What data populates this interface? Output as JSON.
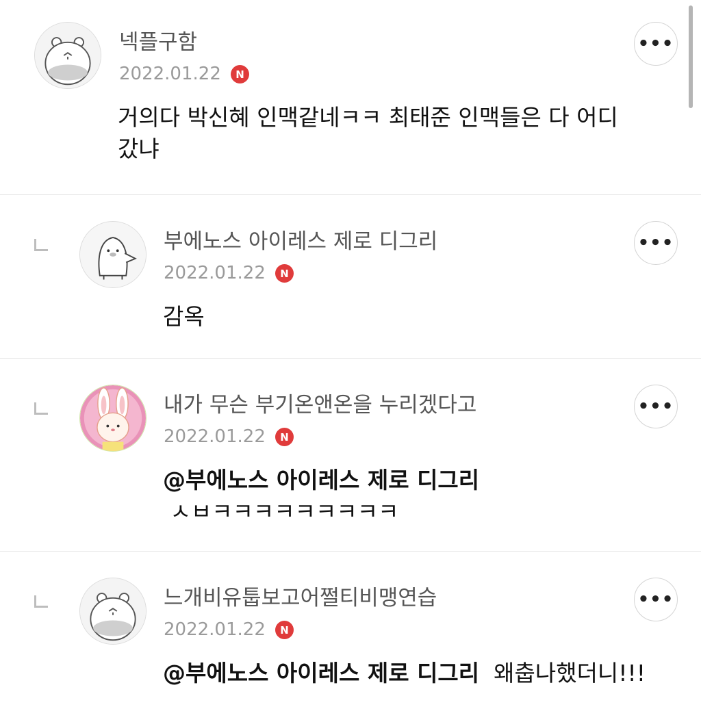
{
  "comments": [
    {
      "nickname": "넥플구함",
      "date": "2022.01.22",
      "badge": "N",
      "avatar_icon": "hamster-avatar-icon",
      "text_line1": "거의다 박신혜 인맥같네ㅋㅋ 최태준 인맥들은 다 어디",
      "text_line2": "갔냐",
      "more_label": "•••"
    },
    {
      "nickname": "부에노스 아이레스 제로 디그리",
      "date": "2022.01.22",
      "badge": "N",
      "avatar_icon": "penguin-avatar-icon",
      "text_line1": "감옥",
      "more_label": "•••"
    },
    {
      "nickname": "내가 무슨 부기온앤온을 누리겠다고",
      "date": "2022.01.22",
      "badge": "N",
      "avatar_icon": "bunny-avatar-icon",
      "mention": "@부에노스 아이레스 제로 디그리",
      "text_line2": " ㅅㅂㅋㅋㅋㅋㅋㅋㅋㅋㅋ",
      "more_label": "•••"
    },
    {
      "nickname": "느개비유툽보고어쩔티비맹연습",
      "date": "2022.01.22",
      "badge": "N",
      "avatar_icon": "hamster-avatar-icon",
      "mention": "@부에노스 아이레스 제로 디그리",
      "text_rest": "  왜춥나했더니!!!",
      "more_label": "•••"
    }
  ],
  "colors": {
    "badge": "#e03b3b",
    "divider": "#e7e7e7",
    "nickname": "#555555",
    "date": "#9a9a9a"
  }
}
